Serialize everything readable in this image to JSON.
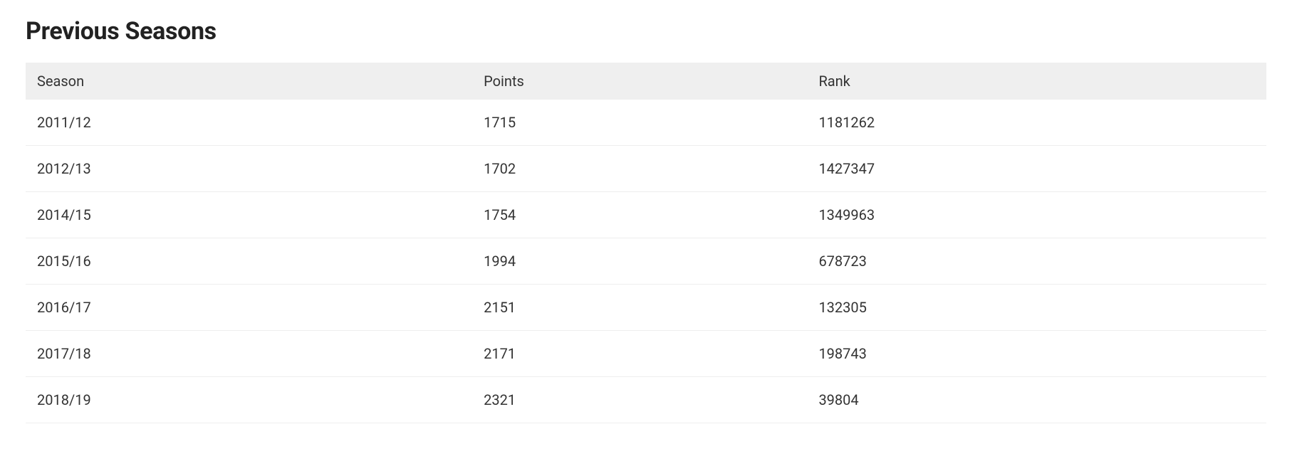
{
  "title": "Previous Seasons",
  "table": {
    "headers": {
      "season": "Season",
      "points": "Points",
      "rank": "Rank"
    },
    "rows": [
      {
        "season": "2011/12",
        "points": "1715",
        "rank": "1181262"
      },
      {
        "season": "2012/13",
        "points": "1702",
        "rank": "1427347"
      },
      {
        "season": "2014/15",
        "points": "1754",
        "rank": "1349963"
      },
      {
        "season": "2015/16",
        "points": "1994",
        "rank": "678723"
      },
      {
        "season": "2016/17",
        "points": "2151",
        "rank": "132305"
      },
      {
        "season": "2017/18",
        "points": "2171",
        "rank": "198743"
      },
      {
        "season": "2018/19",
        "points": "2321",
        "rank": "39804"
      }
    ]
  }
}
